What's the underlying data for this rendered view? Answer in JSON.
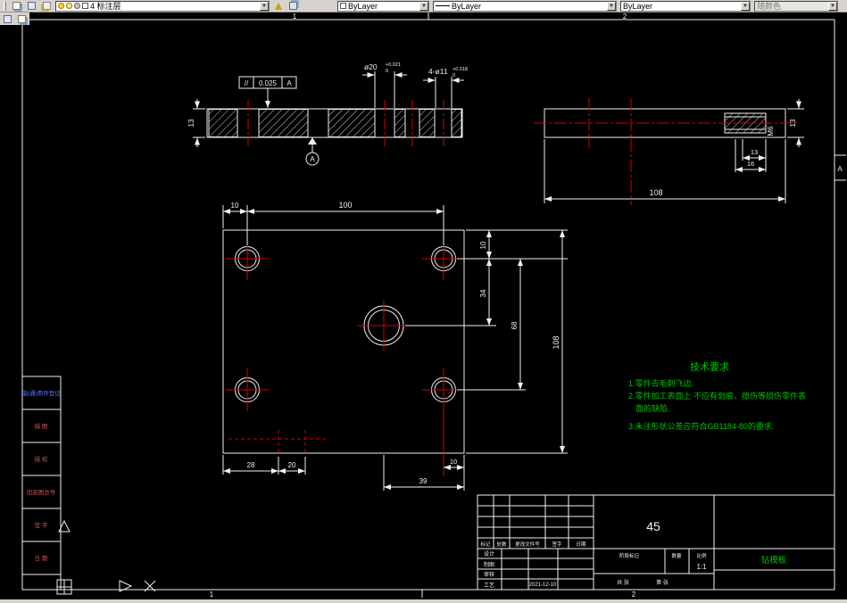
{
  "toolbar": {
    "layer": "4 标注层",
    "color": "ByLayer",
    "linetype": "ByLayer",
    "lineweight": "ByLayer",
    "plot_style": "随颜色"
  },
  "zones": {
    "top_1": "1",
    "top_2": "2",
    "bottom_1": "1",
    "bottom_2": "2",
    "right_a": "A"
  },
  "left_panel": {
    "items": [
      "借(通)用件登记",
      "描 图",
      "描 校",
      "旧底图总号",
      "签 字",
      "日 期"
    ]
  },
  "section_view": {
    "thickness": "13",
    "fcf": {
      "symbol": "//",
      "tolerance": "0.025",
      "datum": "A"
    },
    "datum_label": "A",
    "dia_center": "ø20",
    "dia_center_sup": "+0.021",
    "dia_center_sub": "0",
    "dia_holes": "4-ø11",
    "dia_holes_sup": "+0.018",
    "dia_holes_sub": "0"
  },
  "side_view": {
    "thickness": "13",
    "thread": "M6",
    "depth1": "13",
    "depth2": "16",
    "width": "108"
  },
  "plan_view": {
    "top_offset": "10",
    "hole_span": "100",
    "right_offset": "10",
    "center_offset": "34",
    "vert_span": "68",
    "height": "108",
    "bottom_28": "28",
    "bottom_20": "20",
    "bottom_10": "10",
    "bottom_39": "39"
  },
  "tech_requirements": {
    "title": "技术要求",
    "line1": "1.零件去毛刺飞边.",
    "line2": "2.零件加工表面上 不应有划痕、擦伤等损伤零件表",
    "line3": "面的缺陷.",
    "line4": "3.未注形状公差应符合GB1184-80的要求."
  },
  "title_block": {
    "material": "45",
    "part_name": "钻模板",
    "rev_header": [
      "标记",
      "处数",
      "更改文件号",
      "签字",
      "日期"
    ],
    "roles": [
      "设计",
      "制图",
      "审核",
      "工艺"
    ],
    "date": "2021-12-10",
    "stage_label": "阶段标记",
    "qty_label": "数量",
    "scale_label": "比例",
    "scale": "1:1",
    "sheet_total": "共 张",
    "sheet_no": "第 张"
  }
}
